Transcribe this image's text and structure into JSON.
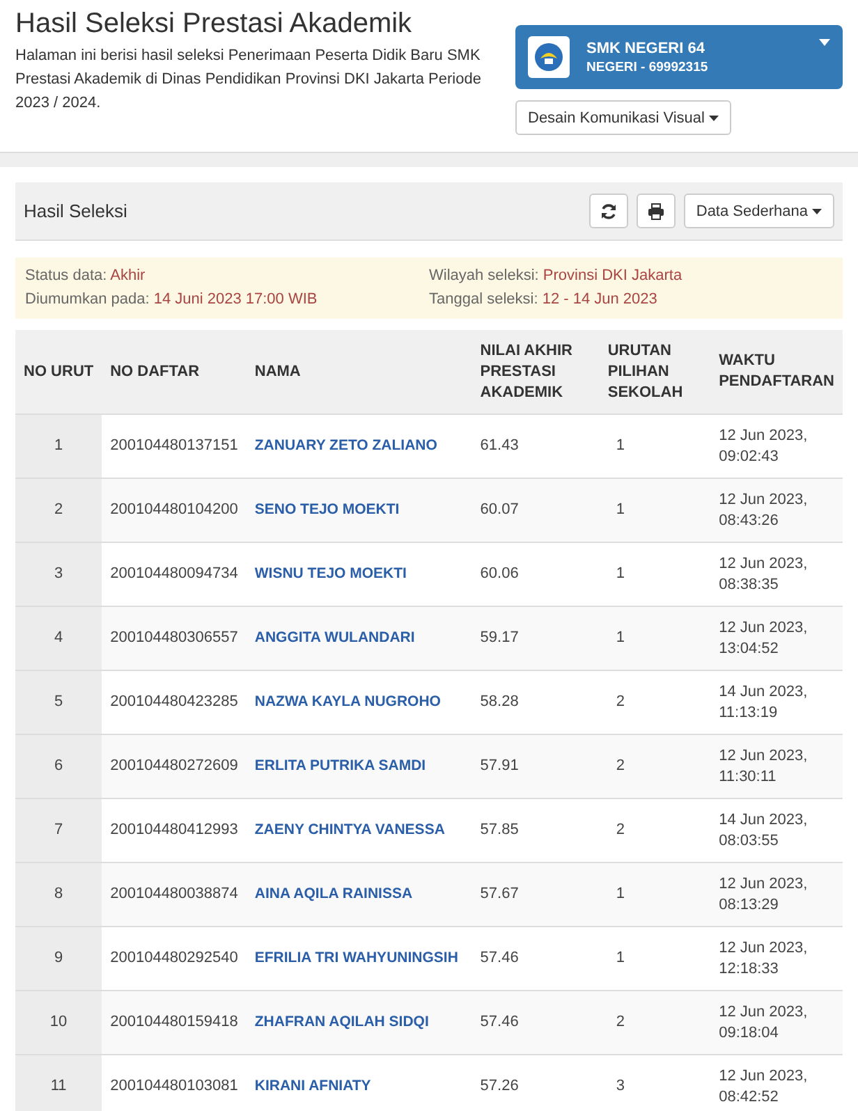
{
  "header": {
    "title": "Hasil Seleksi Prestasi Akademik",
    "description": "Halaman ini berisi hasil seleksi Penerimaan Peserta Didik Baru SMK Prestasi Akademik di Dinas Pendidikan Provinsi DKI Jakarta Periode 2023 / 2024.",
    "school": {
      "name": "SMK NEGERI 64",
      "subtitle": "NEGERI - 69992315"
    },
    "program": "Desain Komunikasi Visual"
  },
  "panel": {
    "title": "Hasil Seleksi",
    "view": "Data Sederhana"
  },
  "info": [
    {
      "label": "Status data:",
      "value": "Akhir"
    },
    {
      "label": "Wilayah seleksi:",
      "value": "Provinsi DKI Jakarta"
    },
    {
      "label": "Diumumkan pada:",
      "value": "14 Juni 2023 17:00 WIB"
    },
    {
      "label": "Tanggal seleksi:",
      "value": "12 - 14 Jun 2023"
    }
  ],
  "table": {
    "columns": [
      "NO URUT",
      "NO DAFTAR",
      "NAMA",
      "NILAI AKHIR PRESTASI AKADEMIK",
      "URUTAN PILIHAN SEKOLAH",
      "WAKTU PENDAFTARAN"
    ],
    "rows": [
      {
        "no": "1",
        "daftar": "200104480137151",
        "nama": "ZANUARY ZETO ZALIANO",
        "nilai": "61.43",
        "urutan": "1",
        "waktu": [
          "12 Jun 2023,",
          "09:02:43"
        ]
      },
      {
        "no": "2",
        "daftar": "200104480104200",
        "nama": "SENO TEJO MOEKTI",
        "nilai": "60.07",
        "urutan": "1",
        "waktu": [
          "12 Jun 2023,",
          "08:43:26"
        ]
      },
      {
        "no": "3",
        "daftar": "200104480094734",
        "nama": "WISNU TEJO MOEKTI",
        "nilai": "60.06",
        "urutan": "1",
        "waktu": [
          "12 Jun 2023,",
          "08:38:35"
        ]
      },
      {
        "no": "4",
        "daftar": "200104480306557",
        "nama": "ANGGITA WULANDARI",
        "nilai": "59.17",
        "urutan": "1",
        "waktu": [
          "12 Jun 2023,",
          "13:04:52"
        ]
      },
      {
        "no": "5",
        "daftar": "200104480423285",
        "nama": "NAZWA KAYLA NUGROHO",
        "nilai": "58.28",
        "urutan": "2",
        "waktu": [
          "14 Jun 2023,",
          "11:13:19"
        ]
      },
      {
        "no": "6",
        "daftar": "200104480272609",
        "nama": "ERLITA PUTRIKA SAMDI",
        "nilai": "57.91",
        "urutan": "2",
        "waktu": [
          "12 Jun 2023,",
          "11:30:11"
        ]
      },
      {
        "no": "7",
        "daftar": "200104480412993",
        "nama": "ZAENY CHINTYA VANESSA",
        "nilai": "57.85",
        "urutan": "2",
        "waktu": [
          "14 Jun 2023,",
          "08:03:55"
        ]
      },
      {
        "no": "8",
        "daftar": "200104480038874",
        "nama": "AINA AQILA RAINISSA",
        "nilai": "57.67",
        "urutan": "1",
        "waktu": [
          "12 Jun 2023,",
          "08:13:29"
        ]
      },
      {
        "no": "9",
        "daftar": "200104480292540",
        "nama": "EFRILIA TRI WAHYUNINGSIH",
        "nilai": "57.46",
        "urutan": "1",
        "waktu": [
          "12 Jun 2023,",
          "12:18:33"
        ]
      },
      {
        "no": "10",
        "daftar": "200104480159418",
        "nama": "ZHAFRAN AQILAH SIDQI",
        "nilai": "57.46",
        "urutan": "2",
        "waktu": [
          "12 Jun 2023,",
          "09:18:04"
        ]
      },
      {
        "no": "11",
        "daftar": "200104480103081",
        "nama": "KIRANI AFNIATY",
        "nilai": "57.26",
        "urutan": "3",
        "waktu": [
          "12 Jun 2023,",
          "08:42:52"
        ]
      }
    ]
  }
}
